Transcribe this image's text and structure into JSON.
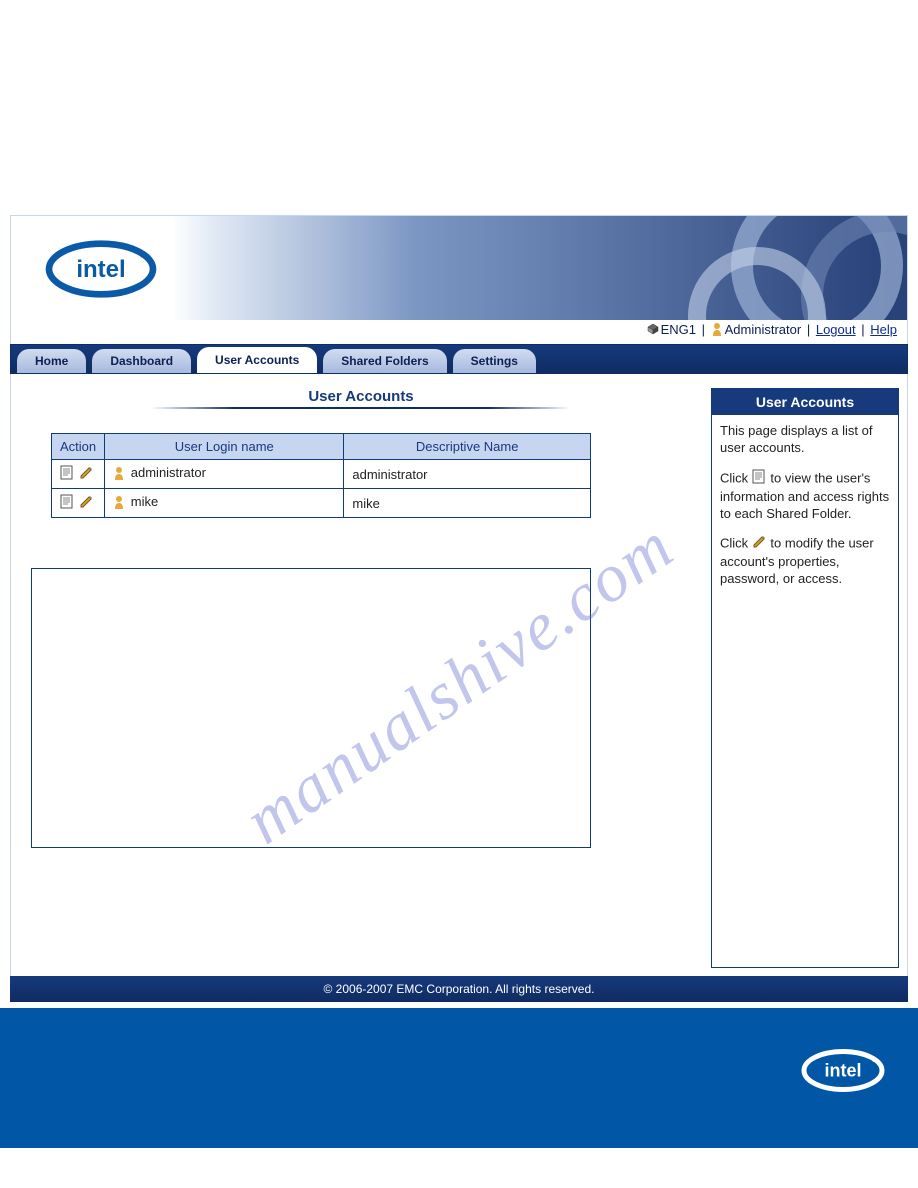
{
  "brand": "intel",
  "userbar": {
    "station": "ENG1",
    "role": "Administrator",
    "logout": "Logout",
    "help": "Help"
  },
  "tabs": [
    {
      "label": "Home",
      "active": false
    },
    {
      "label": "Dashboard",
      "active": false
    },
    {
      "label": "User Accounts",
      "active": true
    },
    {
      "label": "Shared Folders",
      "active": false
    },
    {
      "label": "Settings",
      "active": false
    }
  ],
  "content": {
    "title": "User Accounts",
    "columns": {
      "action": "Action",
      "login": "User Login name",
      "desc": "Descriptive Name"
    },
    "rows": [
      {
        "login": "administrator",
        "desc": "administrator"
      },
      {
        "login": "mike",
        "desc": "mike"
      }
    ]
  },
  "side": {
    "title": "User Accounts",
    "p1": "This page displays a list of user accounts.",
    "p2a": "Click ",
    "p2b": " to view the user's information and access rights to each Shared Folder.",
    "p3a": "Click ",
    "p3b": " to modify the user account's properties, password, or access."
  },
  "footer": "© 2006-2007 EMC Corporation. All rights reserved.",
  "watermark": "manualshive.com"
}
